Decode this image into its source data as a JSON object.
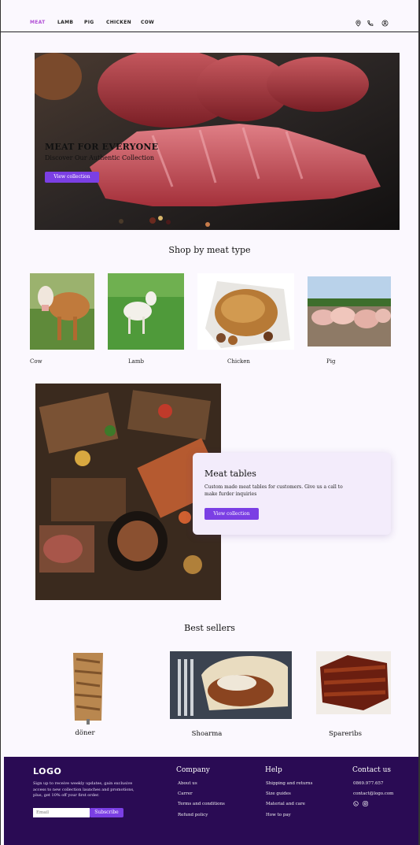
{
  "nav": {
    "links": [
      "MEAT",
      "LAMB",
      "PIG",
      "CHICKEN",
      "COW"
    ],
    "icons": [
      "location-icon",
      "phone-icon",
      "user-icon"
    ]
  },
  "hero": {
    "title": "MEAT FOR EVERYONE",
    "subtitle": "Discover Our Authentic Collection",
    "button": "View collection"
  },
  "shop": {
    "title": "Shop by meat type",
    "types": [
      "Cow",
      "Lamb",
      "Chicken",
      "Pig"
    ]
  },
  "meat_tables": {
    "title": "Meat tables",
    "description": "Custom made meat tables for customers. Give us a call to make furder inquiries",
    "button": "View collection"
  },
  "best_sellers": {
    "title": "Best sellers",
    "items": [
      "döner",
      "Shoarma",
      "Spareribs"
    ]
  },
  "footer": {
    "logo": "LOGO",
    "signup_text": "Sign up to receive weekly updates, gain exclusive access to new collection launches and promotions, plus, get 10% off your first order.",
    "email_placeholder": "Email",
    "subscribe": "Subscribe",
    "company": {
      "title": "Company",
      "links": [
        "About us",
        "Carrer",
        "Terms and conditions",
        "Refund policy"
      ]
    },
    "help": {
      "title": "Help",
      "links": [
        "Shipping and returns",
        "Size guides",
        "Material and care",
        "How to pay"
      ]
    },
    "contact": {
      "title": "Contact us",
      "phone": "0869.977.657",
      "email": "contact@logo.com",
      "social_icons": [
        "whatsapp-icon",
        "instagram-icon"
      ]
    }
  },
  "colors": {
    "accent": "#7b3fe4",
    "active_nav": "#b14fd6",
    "footer_bg": "#2a0b54"
  }
}
